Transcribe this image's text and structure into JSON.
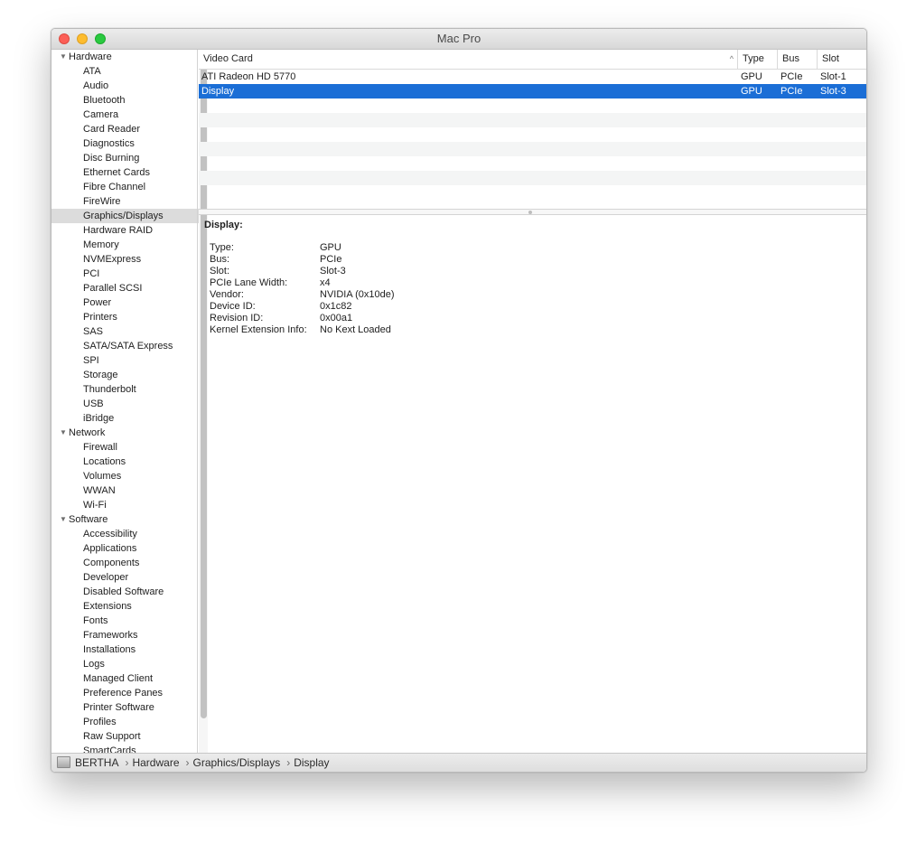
{
  "window": {
    "title": "Mac Pro"
  },
  "sidebar": {
    "groups": [
      {
        "label": "Hardware",
        "items": [
          "ATA",
          "Audio",
          "Bluetooth",
          "Camera",
          "Card Reader",
          "Diagnostics",
          "Disc Burning",
          "Ethernet Cards",
          "Fibre Channel",
          "FireWire",
          "Graphics/Displays",
          "Hardware RAID",
          "Memory",
          "NVMExpress",
          "PCI",
          "Parallel SCSI",
          "Power",
          "Printers",
          "SAS",
          "SATA/SATA Express",
          "SPI",
          "Storage",
          "Thunderbolt",
          "USB",
          "iBridge"
        ]
      },
      {
        "label": "Network",
        "items": [
          "Firewall",
          "Locations",
          "Volumes",
          "WWAN",
          "Wi-Fi"
        ]
      },
      {
        "label": "Software",
        "items": [
          "Accessibility",
          "Applications",
          "Components",
          "Developer",
          "Disabled Software",
          "Extensions",
          "Fonts",
          "Frameworks",
          "Installations",
          "Logs",
          "Managed Client",
          "Preference Panes",
          "Printer Software",
          "Profiles",
          "Raw Support",
          "SmartCards"
        ]
      }
    ],
    "selected": "Graphics/Displays"
  },
  "table": {
    "columns": [
      "Video Card",
      "Type",
      "Bus",
      "Slot"
    ],
    "rows": [
      [
        "ATI Radeon HD 5770",
        "GPU",
        "PCIe",
        "Slot-1"
      ],
      [
        "Display",
        "GPU",
        "PCIe",
        "Slot-3"
      ]
    ],
    "selected_row": 1
  },
  "detail": {
    "title": "Display:",
    "fields": [
      [
        "Type:",
        "GPU"
      ],
      [
        "Bus:",
        "PCIe"
      ],
      [
        "Slot:",
        "Slot-3"
      ],
      [
        "PCIe Lane Width:",
        "x4"
      ],
      [
        "Vendor:",
        "NVIDIA (0x10de)"
      ],
      [
        "Device ID:",
        "0x1c82"
      ],
      [
        "Revision ID:",
        "0x00a1"
      ],
      [
        "Kernel Extension Info:",
        "No Kext Loaded"
      ]
    ]
  },
  "statusbar": {
    "crumbs": [
      "BERTHA",
      "Hardware",
      "Graphics/Displays",
      "Display"
    ],
    "separator": "›"
  },
  "colors": {
    "selection": "#1b6ed6",
    "sidebar_selected": "#dcdcdc"
  }
}
